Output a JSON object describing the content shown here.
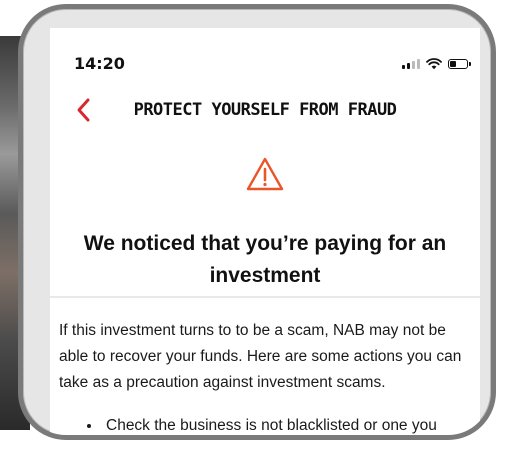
{
  "status_bar": {
    "time": "14:20",
    "battery_level": 0.4
  },
  "nav": {
    "title": "PROTECT YOURSELF FROM FRAUD"
  },
  "warning": {
    "icon": "warning-triangle-icon",
    "headline": "We noticed that you’re paying for an investment"
  },
  "content": {
    "paragraph": "If this investment turns to to be a scam, NAB may not be able to recover your funds. Here are some actions you can take as a precaution against investment scams.",
    "bullets": [
      "Check the business is not blacklisted or one you"
    ]
  },
  "colors": {
    "accent_red": "#d8282f",
    "warning_orange": "#e8562a",
    "text": "#111111",
    "frame": "#7a7a7a"
  }
}
